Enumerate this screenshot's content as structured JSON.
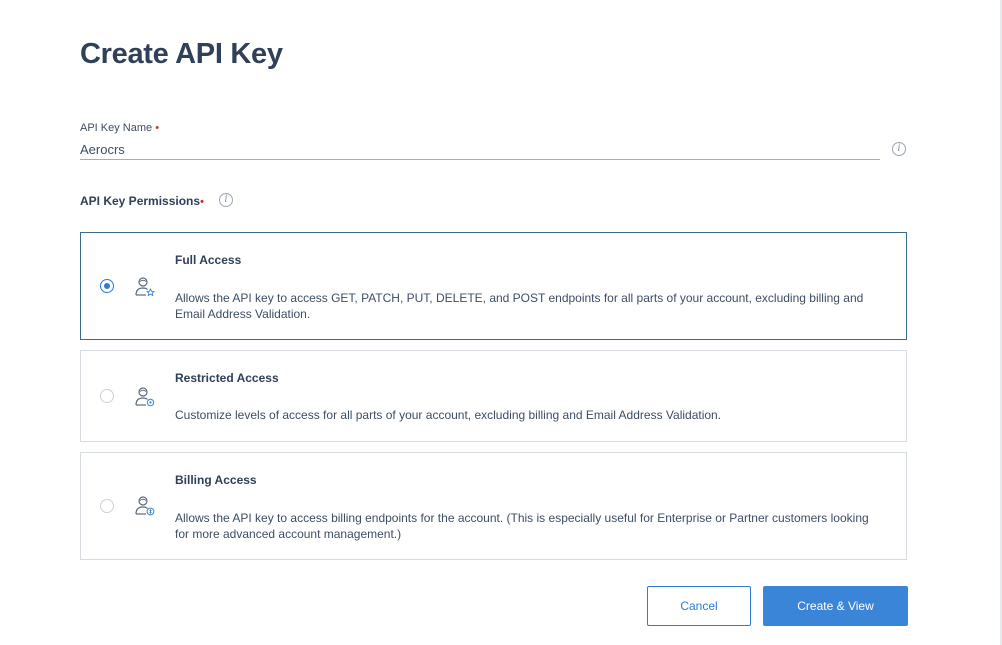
{
  "page": {
    "title": "Create API Key"
  },
  "name_field": {
    "label": "API Key Name",
    "required_mark": "•",
    "value": "Aerocrs",
    "info_icon": "info-icon"
  },
  "permissions": {
    "label": "API Key Permissions",
    "required_mark": "•",
    "info_icon": "info-icon",
    "selected": "full_access",
    "options": [
      {
        "id": "full_access",
        "title": "Full Access",
        "description": "Allows the API key to access GET, PATCH, PUT, DELETE, and POST endpoints for all parts of your account, excluding billing and Email Address Validation.",
        "icon": "user-star-icon",
        "selected": true
      },
      {
        "id": "restricted_access",
        "title": "Restricted Access",
        "description": "Customize levels of access for all parts of your account, excluding billing and Email Address Validation.",
        "icon": "user-gear-icon",
        "selected": false
      },
      {
        "id": "billing_access",
        "title": "Billing Access",
        "description": "Allows the API key to access billing endpoints for the account. (This is especially useful for Enterprise or Partner customers looking for more advanced account management.)",
        "icon": "user-dollar-icon",
        "selected": false
      }
    ]
  },
  "actions": {
    "cancel_label": "Cancel",
    "create_label": "Create & View"
  },
  "colors": {
    "accent": "#3b85d8",
    "title": "#2f4058",
    "required": "#c0392b",
    "selected_border": "#3c6a8a"
  }
}
